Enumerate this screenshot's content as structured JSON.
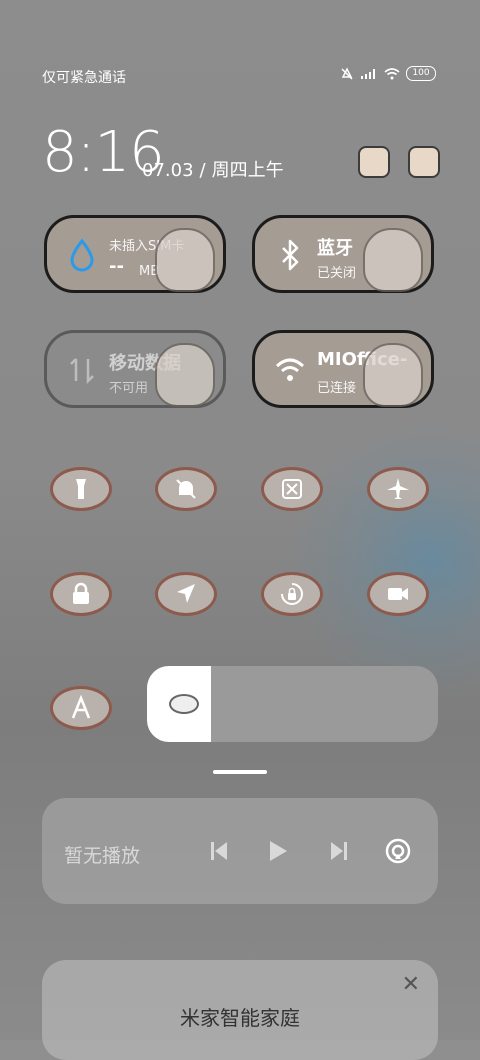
{
  "status_bar": {
    "carrier": "仅可紧急通话",
    "battery": "100",
    "icons": [
      "mute-icon",
      "signal-icon",
      "wifi-icon",
      "battery-icon"
    ]
  },
  "header": {
    "time": "8:16",
    "date": "07.03",
    "weekday": "周四上午",
    "icons": [
      "edit-icon",
      "settings-icon"
    ]
  },
  "tiles": [
    {
      "title": "未插入SIM卡",
      "value": "--",
      "unit": "MB",
      "icon": "data-drop-icon",
      "enabled": true
    },
    {
      "title": "蓝牙",
      "sub": "已关闭",
      "icon": "bluetooth-icon",
      "enabled": true
    },
    {
      "title": "移动数据",
      "sub": "不可用",
      "icon": "mobile-data-icon",
      "enabled": false
    },
    {
      "title": "MIOffice-",
      "sub": "已连接",
      "icon": "wifi-icon",
      "enabled": true
    }
  ],
  "toggles": [
    {
      "icon": "flashlight-icon"
    },
    {
      "icon": "mute-bell-icon"
    },
    {
      "icon": "screenshot-icon"
    },
    {
      "icon": "airplane-icon"
    },
    {
      "icon": "lock-screen-icon"
    },
    {
      "icon": "location-icon"
    },
    {
      "icon": "rotation-lock-icon"
    },
    {
      "icon": "screen-record-icon"
    },
    {
      "icon": "auto-brightness-icon"
    }
  ],
  "brightness": {
    "level": 0.22
  },
  "media": {
    "label": "暂无播放",
    "controls": [
      "previous-icon",
      "play-icon",
      "next-icon",
      "cast-icon"
    ]
  },
  "smart_home": {
    "title": "米家智能家庭"
  }
}
